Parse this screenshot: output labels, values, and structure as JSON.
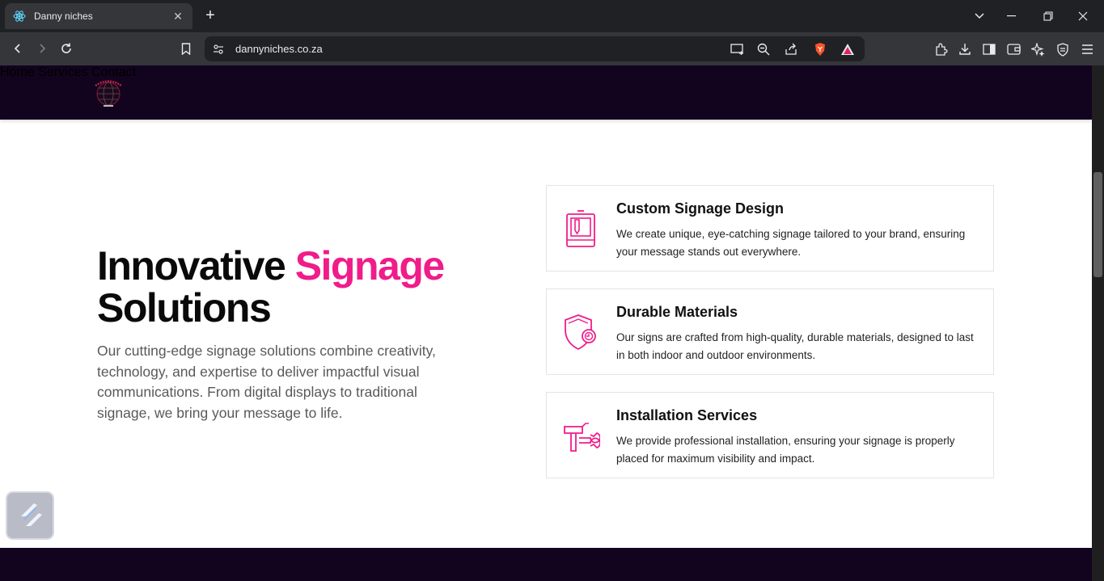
{
  "browser": {
    "tab_title": "Danny niches",
    "url": "dannyniches.co.za"
  },
  "site": {
    "nav": [
      {
        "label": "Home"
      },
      {
        "label": "Services"
      },
      {
        "label": "Contact"
      }
    ],
    "hero": {
      "title_part1": "Innovative ",
      "title_accent": "Signage",
      "title_part2": "Solutions",
      "text": "Our cutting-edge signage solutions combine creativity, technology, and expertise to deliver impactful visual communications. From digital displays to traditional signage, we bring your message to life."
    },
    "services": [
      {
        "title": "Custom Signage Design",
        "description": "We create unique, eye-catching signage tailored to your brand, ensuring your message stands out everywhere.",
        "icon": "design-icon"
      },
      {
        "title": "Durable Materials",
        "description": "Our signs are crafted from high-quality, durable materials, designed to last in both indoor and outdoor environments.",
        "icon": "shield-icon"
      },
      {
        "title": "Installation Services",
        "description": "We provide professional installation, ensuring your signage is properly placed for maximum visibility and impact.",
        "icon": "tools-icon"
      }
    ]
  },
  "colors": {
    "accent": "#f01c8a",
    "header_bg": "#12041f"
  }
}
